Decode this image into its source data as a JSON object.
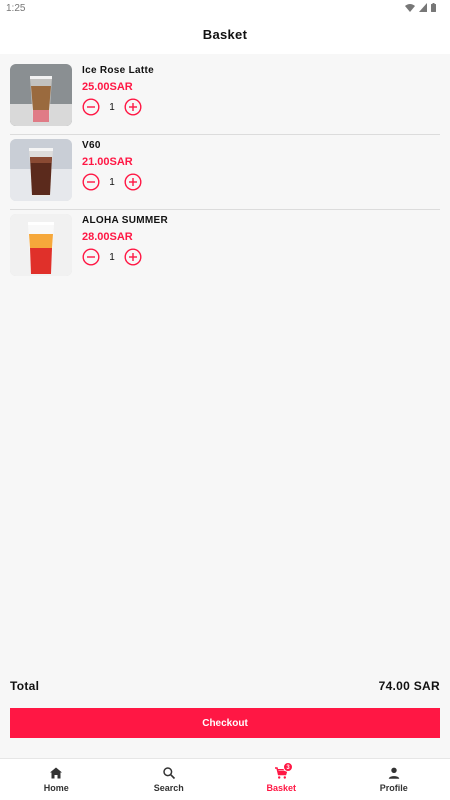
{
  "status_bar": {
    "time": "1:25",
    "icons": [
      "wifi-icon",
      "cell-signal-icon",
      "battery-icon"
    ]
  },
  "header": {
    "title": "Basket"
  },
  "basket": {
    "items": [
      {
        "name": "Ice Rose Latte",
        "price": "25.00SAR",
        "quantity": "1",
        "image": "iced-latte-drink"
      },
      {
        "name": "V60",
        "price": "21.00SAR",
        "quantity": "1",
        "image": "iced-coffee-drink"
      },
      {
        "name": "ALOHA SUMMER",
        "price": "28.00SAR",
        "quantity": "1",
        "image": "orange-red-iced-drink"
      }
    ]
  },
  "summary": {
    "total_label": "Total",
    "total_value": "74.00 SAR"
  },
  "checkout": {
    "label": "Checkout"
  },
  "nav": {
    "items": [
      {
        "label": "Home",
        "icon": "home-icon"
      },
      {
        "label": "Search",
        "icon": "search-icon"
      },
      {
        "label": "Basket",
        "icon": "cart-icon",
        "badge": "3",
        "active": true
      },
      {
        "label": "Profile",
        "icon": "person-icon"
      }
    ]
  },
  "colors": {
    "accent": "#ff1744",
    "background": "#f7f7f7",
    "surface": "#ffffff"
  }
}
